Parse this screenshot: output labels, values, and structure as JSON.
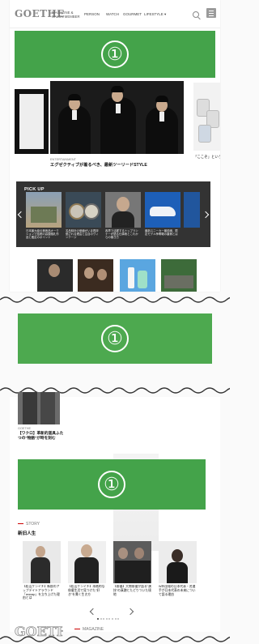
{
  "header": {
    "logo": "GOETHE",
    "logo_sub": "MAGAZINE &\nSALON MEMBER",
    "nav": [
      "PERSON",
      "WATCH",
      "GOURMET",
      "LIFESTYLE ▾"
    ]
  },
  "ads": {
    "top_label": "①",
    "middle_label": "①",
    "lower_label": "①"
  },
  "hero": {
    "category": "ENTERTAINMENT",
    "title": "エグゼクティブが着るべき、最新ツーリードSTYLE",
    "right_title": "「ここぞ」という時の"
  },
  "pickup": {
    "title": "PICK UP",
    "items": [
      {
        "caption": "日本最大級の美術品オークションで話題の高額落札作品と鑑定のポイント"
      },
      {
        "caption": "名品時計の価値がいま再評価される理由と注目のヴィンテージ"
      },
      {
        "caption": "各界で活躍するトップランナーが語る仕事術とこれからの働き方"
      },
      {
        "caption": "最新スニーカー最前線、限定モデル争奪戦の裏側とは"
      }
    ]
  },
  "article": {
    "category": "GOETHE",
    "title": "【ワクロ】革新的道具ふたつの\"物語\"が時を刻む"
  },
  "story": {
    "section": "STORY",
    "subtitle": "新旧人生",
    "items": [
      {
        "caption": "【松山ケンイチ】新鋭のアップデイトアラウンド「rewrap」を立ち上げた理由とは"
      },
      {
        "caption": "【松山ケンイチ】本格的な俳優生活で見つけた\"好き\"を貫く生き方"
      },
      {
        "caption": "【俳優】大物俳優が語る\"演技\"の真髄とたどりついた境地"
      },
      {
        "caption": "W杯出場の日本代表・名選手が日本代表の未来について語る理由"
      }
    ]
  },
  "magazine": {
    "logo": "GOETHE",
    "section": "MAGAZINE"
  }
}
